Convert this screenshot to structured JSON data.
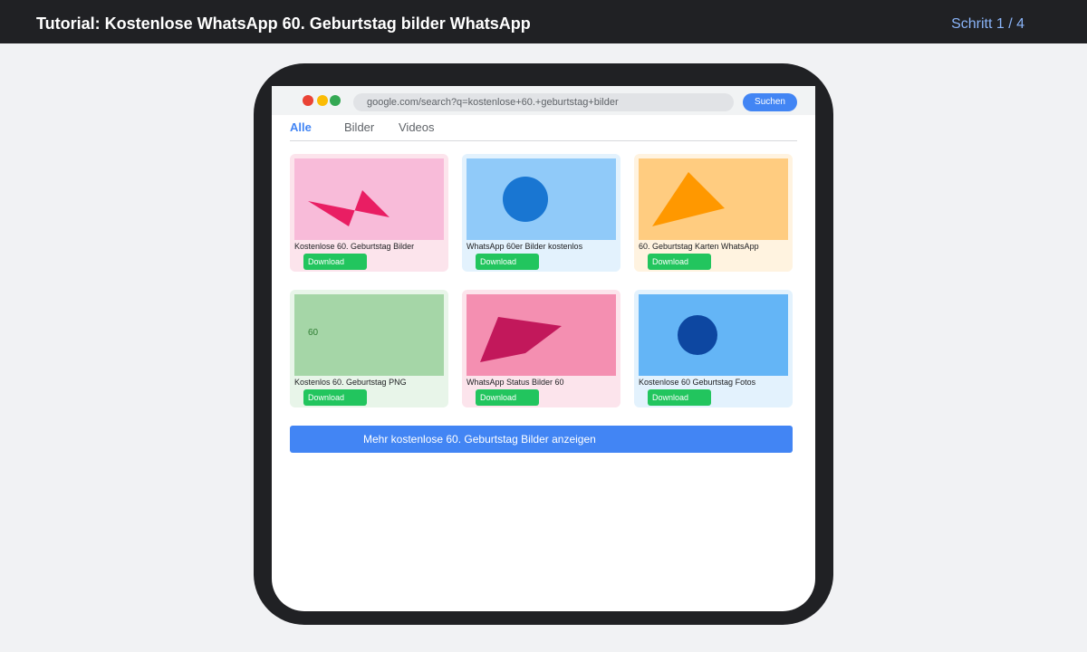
{
  "header": {
    "title": "Tutorial: Kostenlose WhatsApp 60. Geburtstag bilder WhatsApp",
    "step": "Schritt 1 / 4"
  },
  "browser": {
    "url": "google.com/search?q=kostenlose+60.+geburtstag+bilder",
    "search_label": "Suchen"
  },
  "tabs": [
    {
      "label": "Alle",
      "active": true
    },
    {
      "label": "Bilder",
      "active": false
    },
    {
      "label": "Videos",
      "active": false
    }
  ],
  "results": [
    {
      "caption": "Kostenlose 60. Geburtstag Bilder",
      "download_label": "Download",
      "card_color": "#fce4ec",
      "thumb_color": "#f8bbd9",
      "shape_color": "#e91e63",
      "shape": "bowtie"
    },
    {
      "caption": "WhatsApp 60er Bilder kostenlos",
      "download_label": "Download",
      "card_color": "#e3f2fd",
      "thumb_color": "#90caf9",
      "shape_color": "#1976d2",
      "shape": "circle"
    },
    {
      "caption": "60. Geburtstag Karten WhatsApp",
      "download_label": "Download",
      "card_color": "#fff3e0",
      "thumb_color": "#ffcc80",
      "shape_color": "#ff9800",
      "shape": "triangle"
    },
    {
      "caption": "Kostenlos 60. Geburtstag PNG",
      "download_label": "Download",
      "card_color": "#e8f5e9",
      "thumb_color": "#a5d6a7",
      "thumb_text": "60",
      "shape": "text"
    },
    {
      "caption": "WhatsApp Status Bilder 60",
      "download_label": "Download",
      "card_color": "#fce4ec",
      "thumb_color": "#f48fb1",
      "shape_color": "#c2185b",
      "shape": "bowtie"
    },
    {
      "caption": "Kostenlose 60 Geburtstag Fotos",
      "download_label": "Download",
      "card_color": "#e3f2fd",
      "thumb_color": "#64b5f6",
      "shape_color": "#0d47a1",
      "shape": "circle"
    }
  ],
  "more_button_label": "Mehr kostenlose 60. Geburtstag Bilder anzeigen"
}
